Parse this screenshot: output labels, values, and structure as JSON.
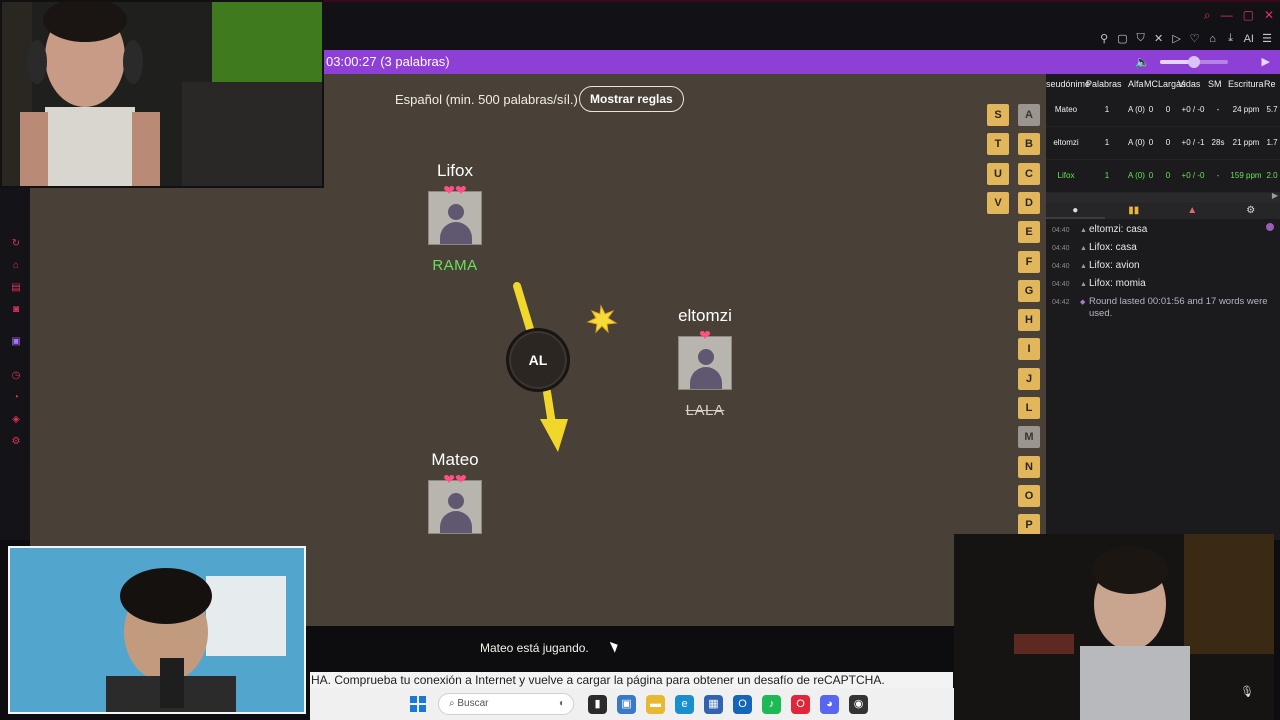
{
  "window": {
    "controls": [
      "⌕",
      "—",
      "▢",
      "✕"
    ],
    "toolbar_icons": [
      "pin-icon",
      "screenshot-icon",
      "shield-icon",
      "translate-icon",
      "play-icon",
      "heart-icon",
      "bag-icon",
      "download-icon",
      "ai-icon",
      "menu-icon"
    ],
    "toolbar_ai_label": "AI"
  },
  "header": {
    "timer_text": "03:00:27 (3 palabras)",
    "volume_fraction": 0.5
  },
  "game": {
    "language_text": "Español (min. 500 palabras/síl.)",
    "rules_button": "Mostrar reglas",
    "syllable": "AL",
    "status_text": "Mateo está jugando.",
    "players": [
      {
        "name": "Lifox",
        "hearts": "❤❤",
        "word": "RAMA",
        "word_style": "green"
      },
      {
        "name": "eltomzi",
        "hearts": "❤",
        "word": "LALA",
        "word_style": "strike"
      },
      {
        "name": "Mateo",
        "hearts": "❤❤",
        "word": "",
        "word_style": ""
      }
    ],
    "bonus_letters": [
      {
        "letter": "S",
        "used": false
      },
      {
        "letter": "T",
        "used": false
      },
      {
        "letter": "U",
        "used": false
      },
      {
        "letter": "V",
        "used": false
      },
      {
        "letter": "A",
        "used": true
      },
      {
        "letter": "B",
        "used": false
      },
      {
        "letter": "C",
        "used": false
      },
      {
        "letter": "D",
        "used": false
      },
      {
        "letter": "E",
        "used": false
      },
      {
        "letter": "F",
        "used": false
      },
      {
        "letter": "G",
        "used": false
      },
      {
        "letter": "H",
        "used": false
      },
      {
        "letter": "I",
        "used": false
      },
      {
        "letter": "J",
        "used": false
      },
      {
        "letter": "L",
        "used": false
      },
      {
        "letter": "M",
        "used": true
      },
      {
        "letter": "N",
        "used": false
      },
      {
        "letter": "O",
        "used": false
      },
      {
        "letter": "P",
        "used": false
      }
    ]
  },
  "scoreboard": {
    "headers": [
      "seudónimo",
      "Palabras",
      "Alfa",
      "MC",
      "Largas",
      "Vidas",
      "SM",
      "Escritura",
      "Re"
    ],
    "rows": [
      {
        "name": "Mateo",
        "words": "1",
        "alpha": "A (0)",
        "mc": "0",
        "long": "0",
        "lives": "+0 / -0",
        "sm": "-",
        "speed": "24 ppm",
        "rest": "5.7",
        "me": false
      },
      {
        "name": "eltomzi",
        "words": "1",
        "alpha": "A (0)",
        "mc": "0",
        "long": "0",
        "lives": "+0 / -1",
        "sm": "28s",
        "speed": "21 ppm",
        "rest": "1.7",
        "me": false
      },
      {
        "name": "Lifox",
        "words": "1",
        "alpha": "A (0)",
        "mc": "0",
        "long": "0",
        "lives": "+0 / -0",
        "sm": "-",
        "speed": "159 ppm",
        "rest": "2.0",
        "me": true
      }
    ]
  },
  "chat": {
    "tabs": [
      "chat-bubble-icon",
      "players-icon",
      "bell-icon",
      "settings-icon"
    ],
    "messages": [
      {
        "time": "04:40",
        "text": "eltomzi: casa",
        "system": false
      },
      {
        "time": "04:40",
        "text": "Lifox: casa",
        "system": false
      },
      {
        "time": "04:40",
        "text": "Lifox: avion",
        "system": false
      },
      {
        "time": "04:40",
        "text": "Lifox: momia",
        "system": false
      },
      {
        "time": "04:42",
        "text": "Round lasted 00:01:56 and 17 words were used.",
        "system": true
      }
    ]
  },
  "captcha_text": "HA. Comprueba tu conexión a Internet y vuelve a cargar la página para obtener un desafío de reCAPTCHA.",
  "taskbar": {
    "search_placeholder": "Buscar",
    "apps": [
      {
        "name": "files-icon",
        "color": "#2b2b2b",
        "glyph": "▮"
      },
      {
        "name": "photos-icon",
        "color": "#3a79c8",
        "glyph": "▣"
      },
      {
        "name": "folder-icon",
        "color": "#e8b830",
        "glyph": "▬"
      },
      {
        "name": "edge-icon",
        "color": "#1a8fd0",
        "glyph": "e"
      },
      {
        "name": "calculator-icon",
        "color": "#3163b0",
        "glyph": "▦"
      },
      {
        "name": "outlook-icon",
        "color": "#1366b8",
        "glyph": "O"
      },
      {
        "name": "spotify-icon",
        "color": "#1db954",
        "glyph": "♪"
      },
      {
        "name": "opera-icon",
        "color": "#e1263a",
        "glyph": "O"
      },
      {
        "name": "discord-icon",
        "color": "#5865f2",
        "glyph": "◕"
      },
      {
        "name": "davinci-icon",
        "color": "#333333",
        "glyph": "◉"
      }
    ]
  },
  "colors": {
    "accent_purple": "#8d3fd6",
    "game_bg": "#494038",
    "bonus_letter": "#e2b65a",
    "bomb_arrow": "#f2d72b",
    "heart": "#ff4f86",
    "green_word": "#6be05a"
  }
}
